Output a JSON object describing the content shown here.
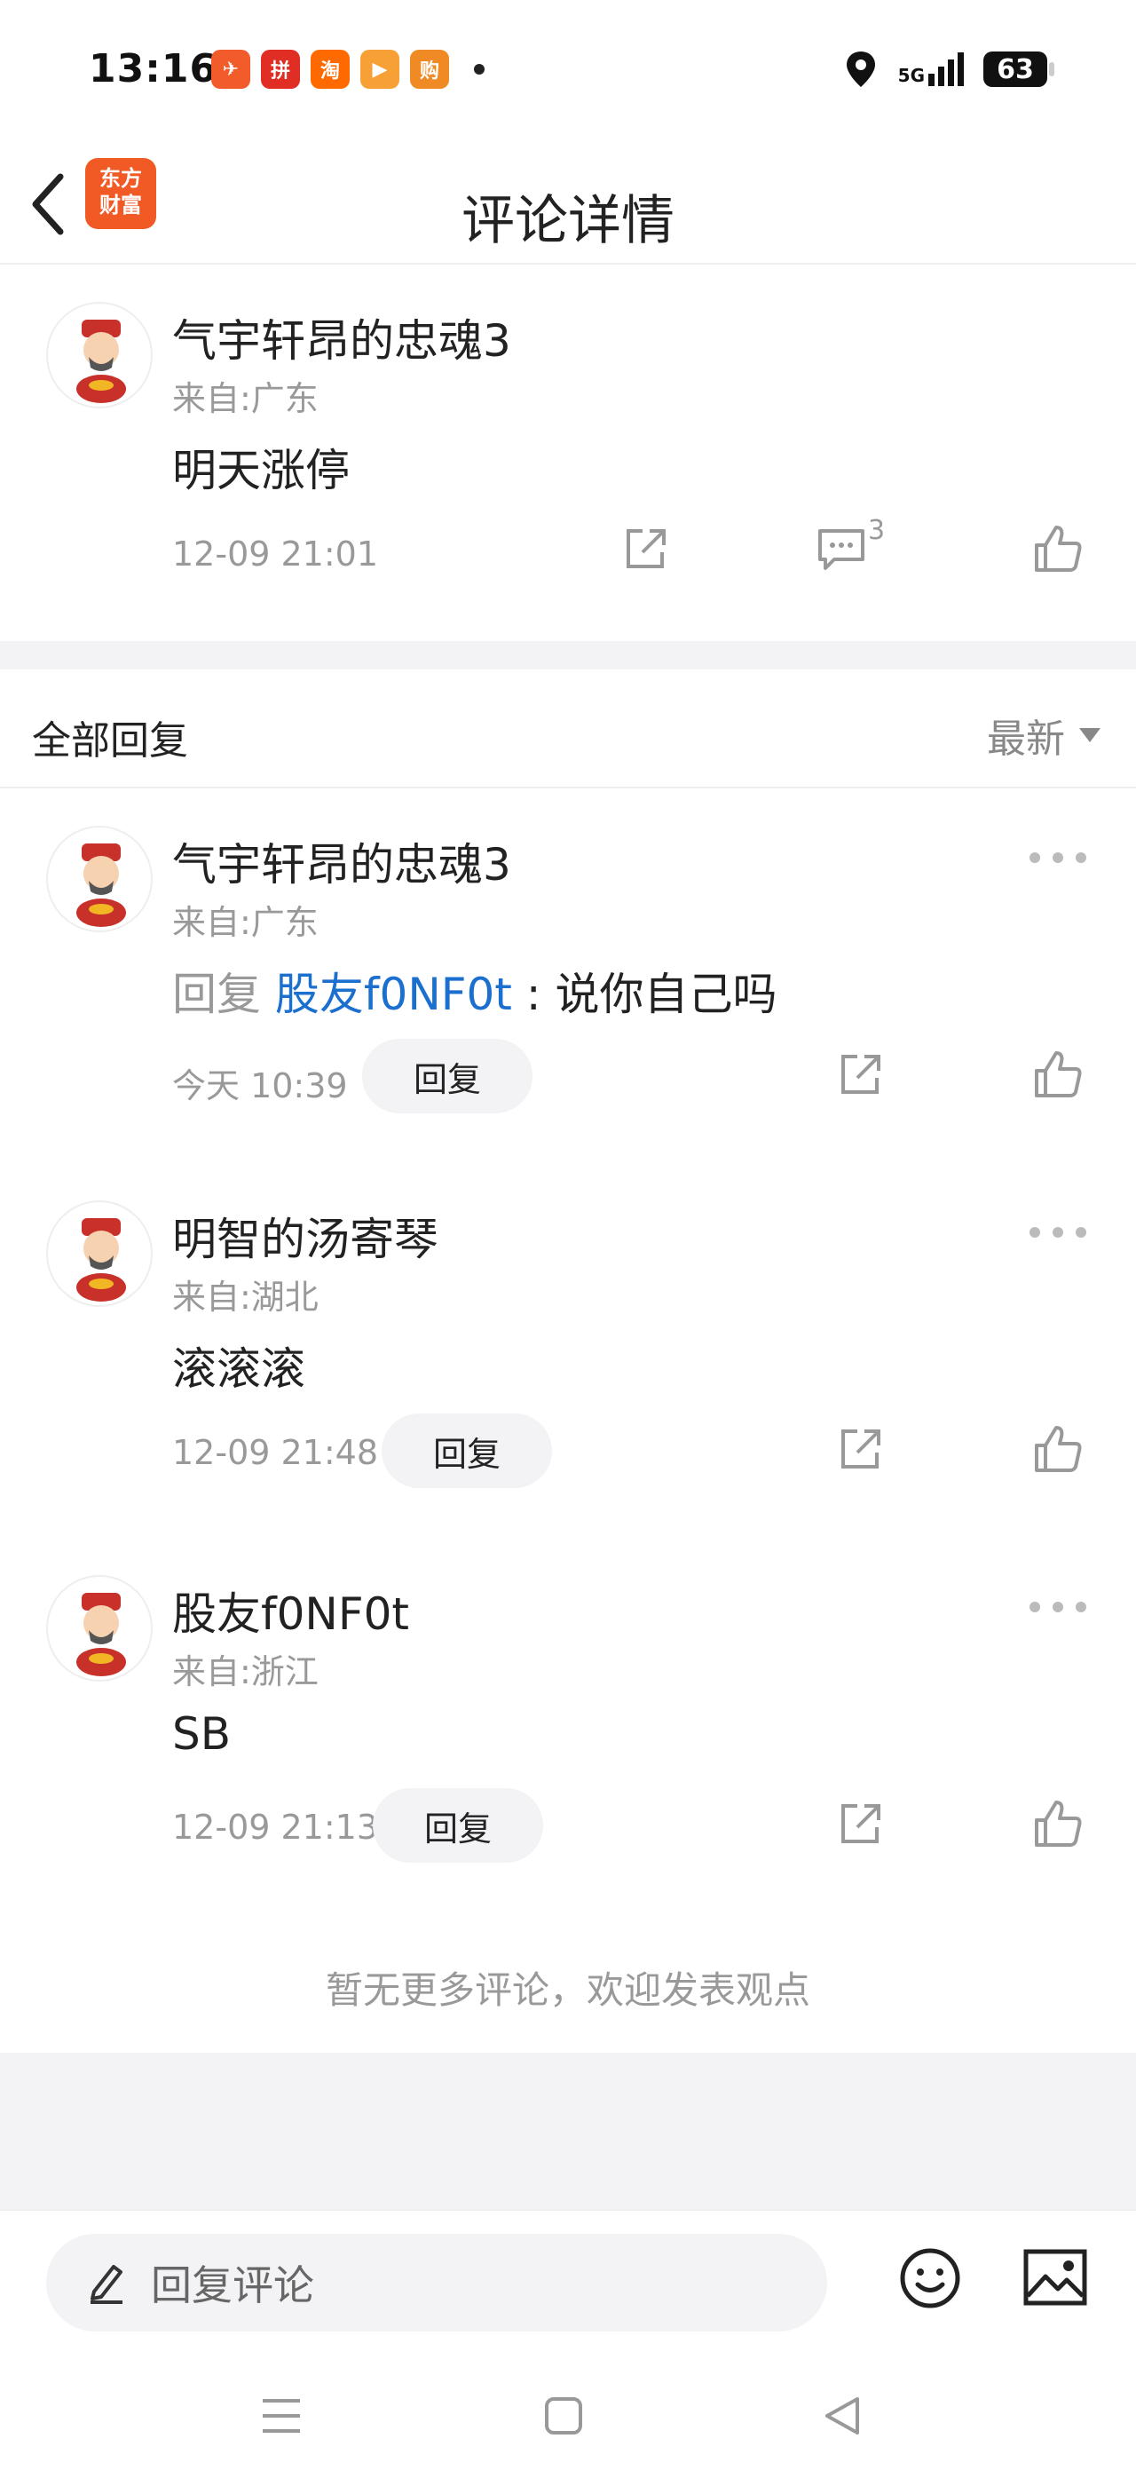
{
  "status_bar": {
    "time": "13:16",
    "apps": [
      {
        "name": "feishu-app-icon",
        "color": "#f25c2a",
        "glyph": "✈"
      },
      {
        "name": "pinduoduo-app-icon",
        "color": "#e02e24",
        "glyph": "拼"
      },
      {
        "name": "taobao-app-icon",
        "color": "#ff6a00",
        "glyph": "淘"
      },
      {
        "name": "video-app-icon",
        "color": "#f7a035",
        "glyph": "▶"
      },
      {
        "name": "shop-app-icon",
        "color": "#f08a24",
        "glyph": "购"
      }
    ],
    "network": "5G",
    "battery": "63"
  },
  "header": {
    "title": "评论详情",
    "logo_line1": "东方",
    "logo_line2": "财富"
  },
  "main_comment": {
    "username": "气宇轩昂的忠魂3",
    "region": "来自:广东",
    "text": "明天涨停",
    "time": "12-09 21:01",
    "comment_count": "3"
  },
  "replies_header": {
    "label": "全部回复",
    "sort": "最新"
  },
  "replies": [
    {
      "username": "气宇轩昂的忠魂3",
      "region": "来自:广东",
      "prefix": "回复 ",
      "target": "股友f0NF0t",
      "text": " : 说你自己吗",
      "time": "今天 10:39",
      "reply_label": "回复"
    },
    {
      "username": "明智的汤寄琴",
      "region": "来自:湖北",
      "text": "滚滚滚",
      "time": "12-09 21:48",
      "reply_label": "回复"
    },
    {
      "username": "股友f0NF0t",
      "region": "来自:浙江",
      "text": "SB",
      "time": "12-09 21:13",
      "reply_label": "回复"
    }
  ],
  "no_more": "暂无更多评论，欢迎发表观点",
  "input_bar": {
    "placeholder": "回复评论"
  }
}
